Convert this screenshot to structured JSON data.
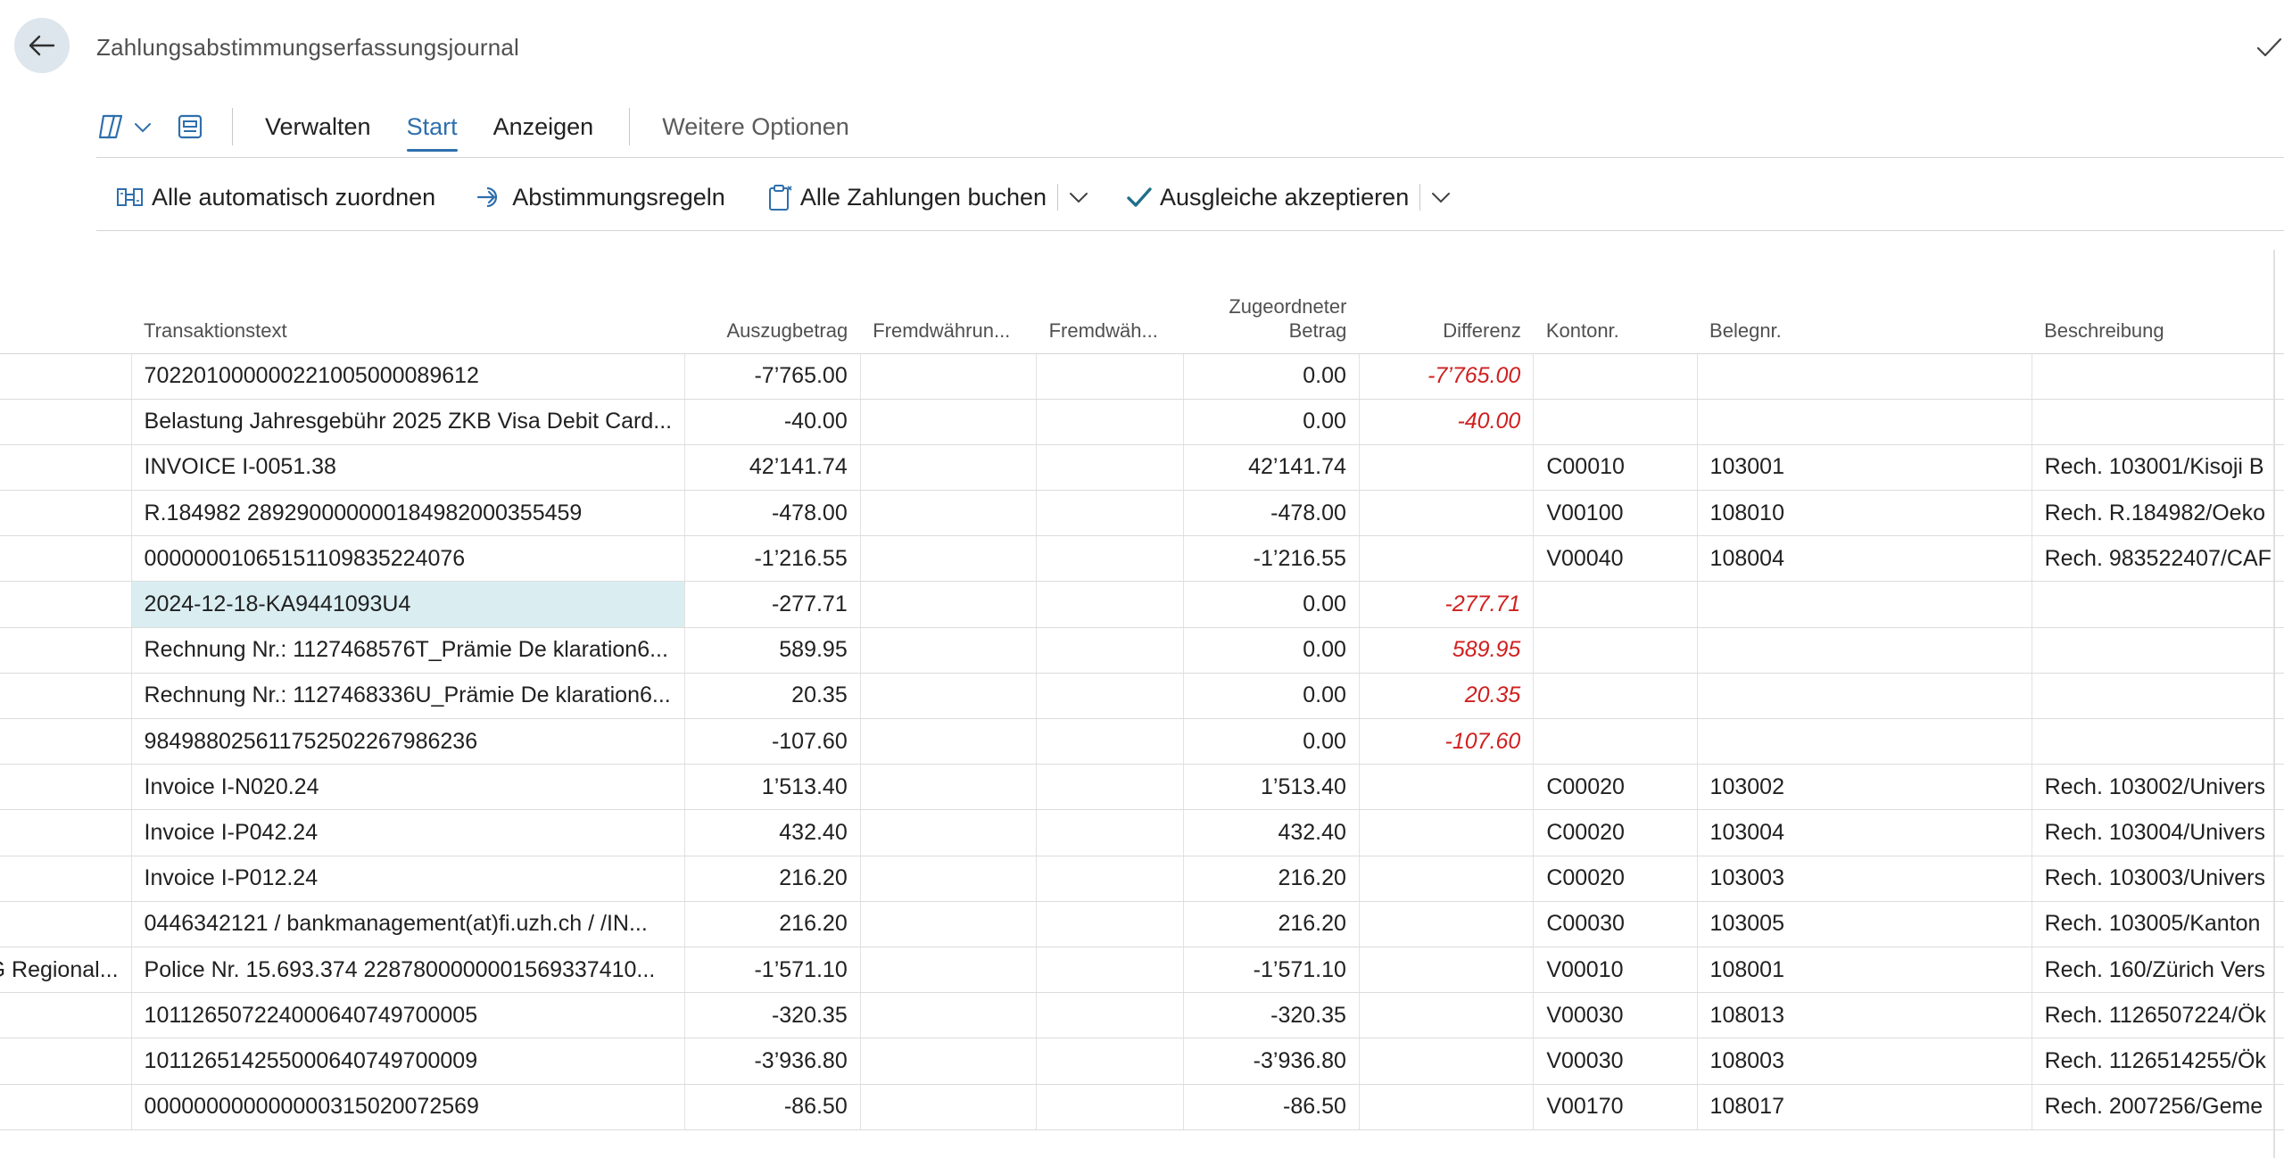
{
  "page": {
    "title": "Zahlungsabstimmungserfassungsjournal"
  },
  "actionbar": {
    "tabs": [
      {
        "label": "Verwalten",
        "active": false
      },
      {
        "label": "Start",
        "active": true
      },
      {
        "label": "Anzeigen",
        "active": false
      }
    ],
    "more_label": "Weitere Optionen"
  },
  "commands": {
    "auto_match": "Alle automatisch zuordnen",
    "rules": "Abstimmungsregeln",
    "post_all": "Alle Zahlungen buchen",
    "accept_apps": "Ausgleiche akzeptieren"
  },
  "colors": {
    "accent": "#2e6fad",
    "negative_diff": "#d02020",
    "selected_row": "#daeef2",
    "back_button_bg": "#dde6ec"
  },
  "table": {
    "columns": [
      {
        "key": "partner",
        "label": ""
      },
      {
        "key": "text",
        "label": "Transaktionstext"
      },
      {
        "key": "amount",
        "label": "Auszugbetrag"
      },
      {
        "key": "fx1",
        "label": "Fremdwährun..."
      },
      {
        "key": "fx2",
        "label": "Fremdwäh..."
      },
      {
        "key": "applied",
        "label": "Zugeordneter Betrag"
      },
      {
        "key": "diff",
        "label": "Differenz"
      },
      {
        "key": "account",
        "label": "Kontonr."
      },
      {
        "key": "doc",
        "label": "Belegnr."
      },
      {
        "key": "desc",
        "label": "Beschreibung"
      }
    ],
    "rows": [
      {
        "partner": "",
        "text": "702201000000221005000089612",
        "amount": "-7’765.00",
        "fx1": "",
        "fx2": "",
        "applied": "0.00",
        "diff": "-7’765.00",
        "account": "",
        "doc": "",
        "desc": ""
      },
      {
        "partner": "",
        "text": "Belastung Jahresgebühr 2025 ZKB Visa Debit Card...",
        "amount": "-40.00",
        "fx1": "",
        "fx2": "",
        "applied": "0.00",
        "diff": "-40.00",
        "account": "",
        "doc": "",
        "desc": ""
      },
      {
        "partner": "",
        "text": "INVOICE I-0051.38",
        "amount": "42’141.74",
        "fx1": "",
        "fx2": "",
        "applied": "42’141.74",
        "diff": "",
        "account": "C00010",
        "doc": "103001",
        "desc": "Rech. 103001/Kisoji B"
      },
      {
        "partner": "",
        "text": "R.184982 289290000000184982000355459",
        "amount": "-478.00",
        "fx1": "",
        "fx2": "",
        "applied": "-478.00",
        "diff": "",
        "account": "V00100",
        "doc": "108010",
        "desc": "Rech. R.184982/Oeko"
      },
      {
        "partner": "",
        "text": "000000010651511098352240​76",
        "amount": "-1’216.55",
        "fx1": "",
        "fx2": "",
        "applied": "-1’216.55",
        "diff": "",
        "account": "V00040",
        "doc": "108004",
        "desc": "Rech. 983522407/CAF"
      },
      {
        "partner": "",
        "text": "2024-12-18-KA9441093U4",
        "amount": "-277.71",
        "fx1": "",
        "fx2": "",
        "applied": "0.00",
        "diff": "-277.71",
        "account": "",
        "doc": "",
        "desc": ""
      },
      {
        "partner": "",
        "text": "Rechnung Nr.: 1127468576T_Prämie De klaration6...",
        "amount": "589.95",
        "fx1": "",
        "fx2": "",
        "applied": "0.00",
        "diff": "589.95",
        "account": "",
        "doc": "",
        "desc": ""
      },
      {
        "partner": "",
        "text": "Rechnung Nr.: 1127468336U_Prämie De klaration6...",
        "amount": "20.35",
        "fx1": "",
        "fx2": "",
        "applied": "0.00",
        "diff": "20.35",
        "account": "",
        "doc": "",
        "desc": ""
      },
      {
        "partner": "",
        "text": "984988025611752502267986236",
        "amount": "-107.60",
        "fx1": "",
        "fx2": "",
        "applied": "0.00",
        "diff": "-107.60",
        "account": "",
        "doc": "",
        "desc": ""
      },
      {
        "partner": "",
        "text": "Invoice I-N020.24",
        "amount": "1’513.40",
        "fx1": "",
        "fx2": "",
        "applied": "1’513.40",
        "diff": "",
        "account": "C00020",
        "doc": "103002",
        "desc": "Rech. 103002/Univers"
      },
      {
        "partner": "",
        "text": "Invoice I-P042.24",
        "amount": "432.40",
        "fx1": "",
        "fx2": "",
        "applied": "432.40",
        "diff": "",
        "account": "C00020",
        "doc": "103004",
        "desc": "Rech. 103004/Univers"
      },
      {
        "partner": "",
        "text": "Invoice I-P012.24",
        "amount": "216.20",
        "fx1": "",
        "fx2": "",
        "applied": "216.20",
        "diff": "",
        "account": "C00020",
        "doc": "103003",
        "desc": "Rech. 103003/Univers"
      },
      {
        "partner": "",
        "text": "0446342121 / bankmanagement(at)fi.uzh.ch / /IN...",
        "amount": "216.20",
        "fx1": "",
        "fx2": "",
        "applied": "216.20",
        "diff": "",
        "account": "C00030",
        "doc": "103005",
        "desc": "Rech. 103005/Kanton"
      },
      {
        "partner": "G Regional...",
        "text": "Police Nr. 15.693.374 2287800000001569337410...",
        "amount": "-1’571.10",
        "fx1": "",
        "fx2": "",
        "applied": "-1’571.10",
        "diff": "",
        "account": "V00010",
        "doc": "108001",
        "desc": "Rech. 160/Zürich Vers"
      },
      {
        "partner": "",
        "text": "101126507224000640749700005",
        "amount": "-320.35",
        "fx1": "",
        "fx2": "",
        "applied": "-320.35",
        "diff": "",
        "account": "V00030",
        "doc": "108013",
        "desc": "Rech. 1126507224/Ök"
      },
      {
        "partner": "",
        "text": "101126514255000640749700009",
        "amount": "-3’936.80",
        "fx1": "",
        "fx2": "",
        "applied": "-3’936.80",
        "diff": "",
        "account": "V00030",
        "doc": "108003",
        "desc": "Rech. 1126514255/Ök"
      },
      {
        "partner": "",
        "text": "000000000000000315020072569",
        "amount": "-86.50",
        "fx1": "",
        "fx2": "",
        "applied": "-86.50",
        "diff": "",
        "account": "V00170",
        "doc": "108017",
        "desc": "Rech. 2007256/Geme"
      }
    ]
  }
}
